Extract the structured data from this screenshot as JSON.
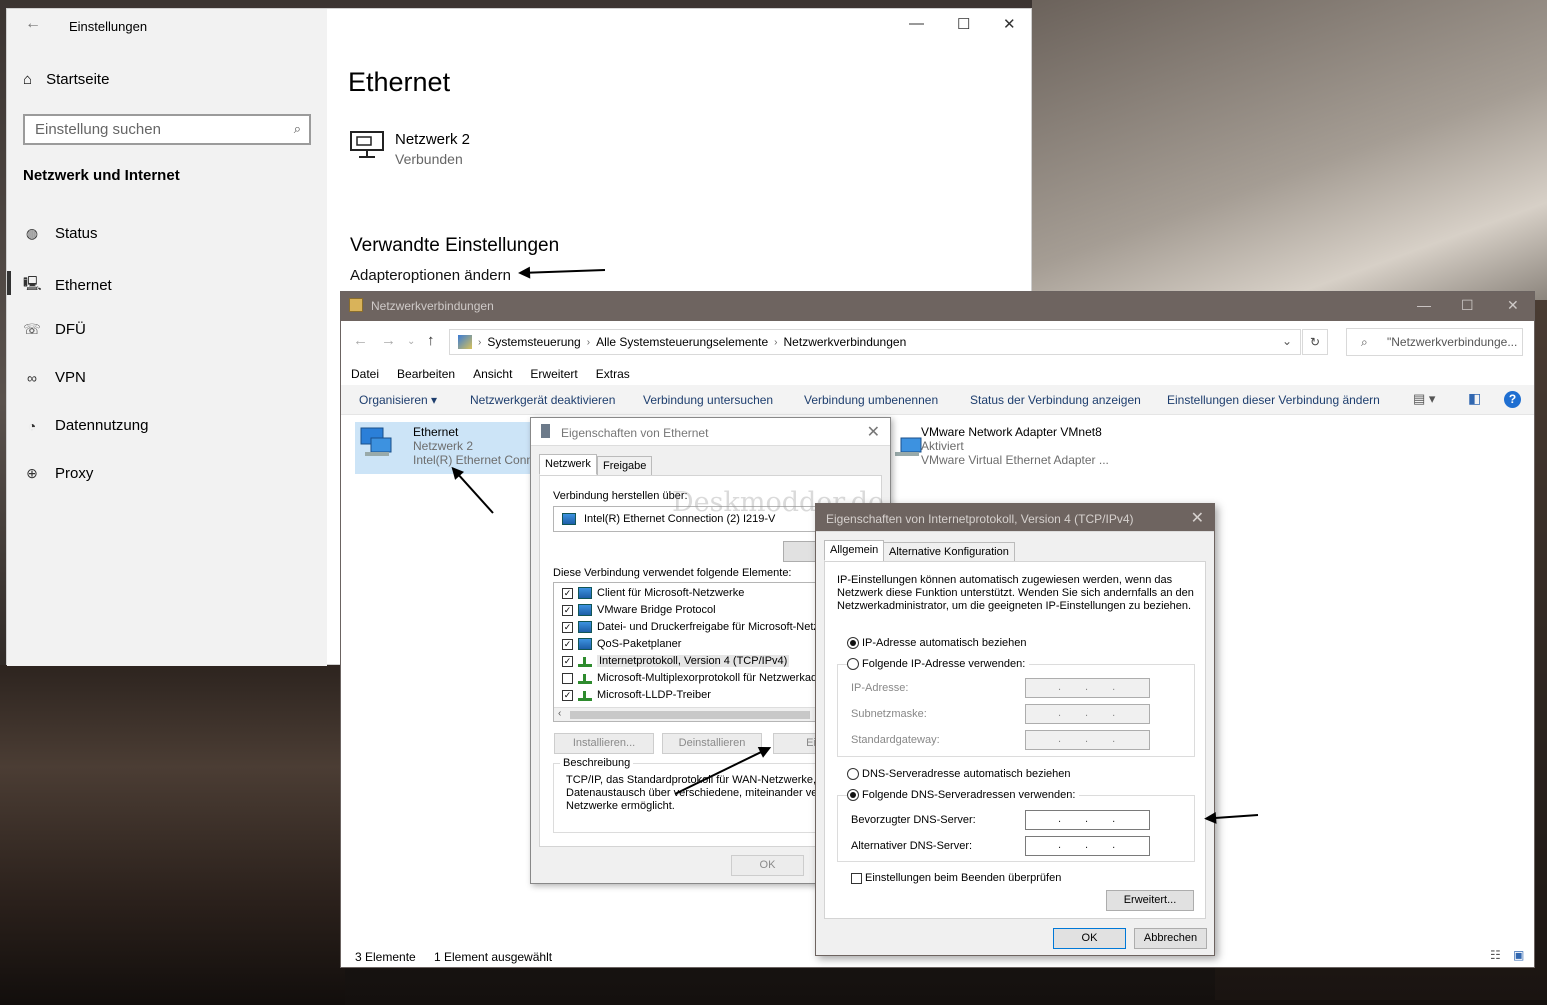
{
  "settings": {
    "window_title": "Einstellungen",
    "home": "Startseite",
    "search_placeholder": "Einstellung suchen",
    "section": "Netzwerk und Internet",
    "nav": [
      "Status",
      "Ethernet",
      "DFÜ",
      "VPN",
      "Datennutzung",
      "Proxy"
    ],
    "page_title": "Ethernet",
    "network_name": "Netzwerk  2",
    "network_status": "Verbunden",
    "related_heading": "Verwandte Einstellungen",
    "adapter_link": "Adapteroptionen ändern"
  },
  "netconn": {
    "window_title": "Netzwerkverbindungen",
    "breadcrumb": [
      "Systemsteuerung",
      "Alle Systemsteuerungselemente",
      "Netzwerkverbindungen"
    ],
    "search_placeholder": "\"Netzwerkverbindunge...",
    "menu": [
      "Datei",
      "Bearbeiten",
      "Ansicht",
      "Erweitert",
      "Extras"
    ],
    "commands": [
      "Organisieren ▾",
      "Netzwerkgerät deaktivieren",
      "Verbindung untersuchen",
      "Verbindung umbenennen",
      "Status der Verbindung anzeigen",
      "Einstellungen dieser Verbindung ändern"
    ],
    "adapters": [
      {
        "name": "Ethernet",
        "network": "Netzwerk  2",
        "device": "Intel(R) Ethernet Conn"
      },
      {
        "name": "VMware Network Adapter VMnet8",
        "network": "Aktiviert",
        "device": "VMware Virtual Ethernet Adapter ..."
      }
    ],
    "status_count": "3 Elemente",
    "status_selected": "1 Element ausgewählt"
  },
  "eth_props": {
    "title": "Eigenschaften von Ethernet",
    "tabs": [
      "Netzwerk",
      "Freigabe"
    ],
    "connect_via_label": "Verbindung herstellen über:",
    "adapter": "Intel(R) Ethernet Connection (2) I219-V",
    "configure_btn": "Konfi",
    "items_label": "Diese Verbindung verwendet folgende Elemente:",
    "items": [
      {
        "label": "Client für Microsoft-Netzwerke",
        "checked": true
      },
      {
        "label": "VMware Bridge Protocol",
        "checked": true
      },
      {
        "label": "Datei- und Druckerfreigabe für Microsoft-Netzw",
        "checked": true
      },
      {
        "label": "QoS-Paketplaner",
        "checked": true
      },
      {
        "label": "Internetprotokoll, Version 4 (TCP/IPv4)",
        "checked": true
      },
      {
        "label": "Microsoft-Multiplexorprotokoll für Netzwerkadap",
        "checked": false
      },
      {
        "label": "Microsoft-LLDP-Treiber",
        "checked": true
      }
    ],
    "install_btn": "Installieren...",
    "uninstall_btn": "Deinstallieren",
    "props_btn": "Eigens",
    "desc_label": "Beschreibung",
    "desc_text": "TCP/IP, das Standardprotokoll für WAN-Netzwerke, d\nDatenaustausch über verschiedene, miteinander verb\nNetzwerke ermöglicht.",
    "ok_btn": "OK"
  },
  "watermark": "Deskmodder.de",
  "ipv4": {
    "title": "Eigenschaften von Internetprotokoll, Version 4 (TCP/IPv4)",
    "tabs": [
      "Allgemein",
      "Alternative Konfiguration"
    ],
    "intro": "IP-Einstellungen können automatisch zugewiesen werden, wenn das Netzwerk diese Funktion unterstützt. Wenden Sie sich andernfalls an den Netzwerkadministrator, um die geeigneten IP-Einstellungen zu beziehen.",
    "ip_auto": "IP-Adresse automatisch beziehen",
    "ip_manual": "Folgende IP-Adresse verwenden:",
    "ip_address": "IP-Adresse:",
    "subnet": "Subnetzmaske:",
    "gateway": "Standardgateway:",
    "dns_auto": "DNS-Serveradresse automatisch beziehen",
    "dns_manual": "Folgende DNS-Serveradressen verwenden:",
    "dns_pref": "Bevorzugter DNS-Server:",
    "dns_alt": "Alternativer DNS-Server:",
    "validate": "Einstellungen beim Beenden überprüfen",
    "advanced_btn": "Erweitert...",
    "ok_btn": "OK",
    "cancel_btn": "Abbrechen",
    "ip_dots": "...",
    "ip_selected": "auto",
    "dns_selected": "manual"
  },
  "colors": {
    "accent": "#0078d7",
    "titlebar_dark": "#6e6460",
    "selection": "#cce4f7"
  }
}
